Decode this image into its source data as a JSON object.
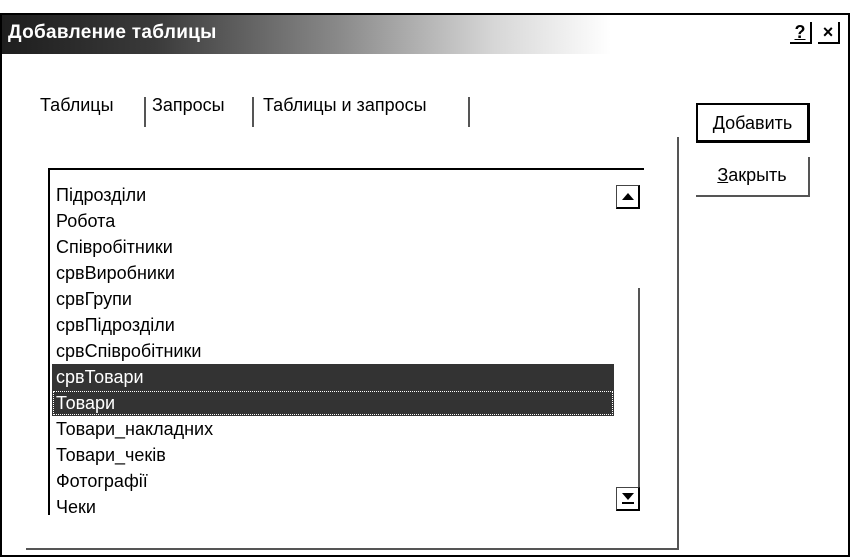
{
  "window": {
    "title": "Добавление таблицы",
    "help_label": "?",
    "close_label": "×"
  },
  "tabs": [
    {
      "label": "Таблицы",
      "active": true
    },
    {
      "label": "Запросы",
      "active": false
    },
    {
      "label": "Таблицы и запросы",
      "active": false
    }
  ],
  "list": {
    "items": [
      "Підрозділи",
      "Робота",
      "Співробітники",
      "срвВиробники",
      "срвГрупи",
      "срвПідрозділи",
      "срвСпівробітники",
      "срвТовари",
      "Товари",
      "Товари_накладних",
      "Товари_чеків",
      "Фотографії",
      "Чеки"
    ],
    "selected": [
      "срвТовари",
      "Товари"
    ]
  },
  "buttons": {
    "add": {
      "mnemonic": "Д",
      "rest": "обавить"
    },
    "close": {
      "mnemonic": "З",
      "rest": "акрыть"
    }
  },
  "colors": {
    "selection": "#333333",
    "title_start": "#1e1e1e"
  }
}
